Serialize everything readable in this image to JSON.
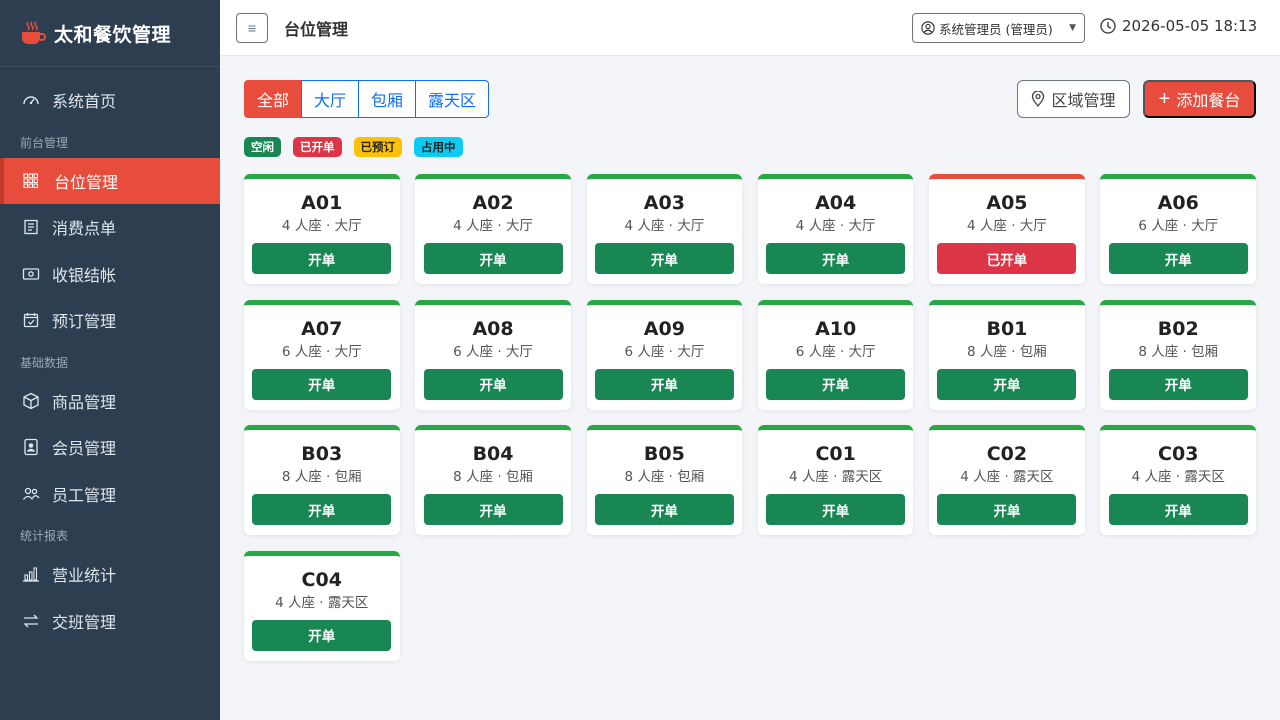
{
  "brand": {
    "title": "太和餐饮管理"
  },
  "sidebar": {
    "items": [
      {
        "type": "item",
        "label": "系统首页",
        "icon": "speedometer-icon",
        "name": "sidebar-item-home"
      },
      {
        "type": "section",
        "label": "前台管理"
      },
      {
        "type": "item",
        "label": "台位管理",
        "icon": "grid-icon",
        "name": "sidebar-item-tables",
        "active": true
      },
      {
        "type": "item",
        "label": "消费点单",
        "icon": "receipt-icon",
        "name": "sidebar-item-orders"
      },
      {
        "type": "item",
        "label": "收银结帐",
        "icon": "cash-icon",
        "name": "sidebar-item-checkout"
      },
      {
        "type": "item",
        "label": "预订管理",
        "icon": "calendar-check-icon",
        "name": "sidebar-item-reservations"
      },
      {
        "type": "section",
        "label": "基础数据"
      },
      {
        "type": "item",
        "label": "商品管理",
        "icon": "box-icon",
        "name": "sidebar-item-products"
      },
      {
        "type": "item",
        "label": "会员管理",
        "icon": "member-card-icon",
        "name": "sidebar-item-members"
      },
      {
        "type": "item",
        "label": "员工管理",
        "icon": "people-icon",
        "name": "sidebar-item-staff"
      },
      {
        "type": "section",
        "label": "统计报表"
      },
      {
        "type": "item",
        "label": "营业统计",
        "icon": "bar-chart-icon",
        "name": "sidebar-item-stats"
      },
      {
        "type": "item",
        "label": "交班管理",
        "icon": "arrows-swap-icon",
        "name": "sidebar-item-shift"
      }
    ]
  },
  "header": {
    "menu_glyph": "≡",
    "title": "台位管理",
    "user_label": "系统管理员 (管理员)",
    "datetime": "2026-05-05 18:13"
  },
  "toolbar": {
    "filters": [
      {
        "label": "全部",
        "active": true
      },
      {
        "label": "大厅",
        "active": false
      },
      {
        "label": "包厢",
        "active": false
      },
      {
        "label": "露天区",
        "active": false
      }
    ],
    "area_button": "区域管理",
    "add_button": "添加餐台",
    "add_glyph": "+"
  },
  "legend": [
    {
      "label": "空闲",
      "color": "green"
    },
    {
      "label": "已开单",
      "color": "red"
    },
    {
      "label": "已预订",
      "color": "yellow"
    },
    {
      "label": "占用中",
      "color": "cyan"
    }
  ],
  "tables": [
    {
      "name": "A01",
      "meta": "4 人座 · 大厅",
      "action": "开单",
      "status": "free"
    },
    {
      "name": "A02",
      "meta": "4 人座 · 大厅",
      "action": "开单",
      "status": "free"
    },
    {
      "name": "A03",
      "meta": "4 人座 · 大厅",
      "action": "开单",
      "status": "free"
    },
    {
      "name": "A04",
      "meta": "4 人座 · 大厅",
      "action": "开单",
      "status": "free"
    },
    {
      "name": "A05",
      "meta": "4 人座 · 大厅",
      "action": "已开单",
      "status": "open"
    },
    {
      "name": "A06",
      "meta": "6 人座 · 大厅",
      "action": "开单",
      "status": "free"
    },
    {
      "name": "A07",
      "meta": "6 人座 · 大厅",
      "action": "开单",
      "status": "free"
    },
    {
      "name": "A08",
      "meta": "6 人座 · 大厅",
      "action": "开单",
      "status": "free"
    },
    {
      "name": "A09",
      "meta": "6 人座 · 大厅",
      "action": "开单",
      "status": "free"
    },
    {
      "name": "A10",
      "meta": "6 人座 · 大厅",
      "action": "开单",
      "status": "free"
    },
    {
      "name": "B01",
      "meta": "8 人座 · 包厢",
      "action": "开单",
      "status": "free"
    },
    {
      "name": "B02",
      "meta": "8 人座 · 包厢",
      "action": "开单",
      "status": "free"
    },
    {
      "name": "B03",
      "meta": "8 人座 · 包厢",
      "action": "开单",
      "status": "free"
    },
    {
      "name": "B04",
      "meta": "8 人座 · 包厢",
      "action": "开单",
      "status": "free"
    },
    {
      "name": "B05",
      "meta": "8 人座 · 包厢",
      "action": "开单",
      "status": "free"
    },
    {
      "name": "C01",
      "meta": "4 人座 · 露天区",
      "action": "开单",
      "status": "free"
    },
    {
      "name": "C02",
      "meta": "4 人座 · 露天区",
      "action": "开单",
      "status": "free"
    },
    {
      "name": "C03",
      "meta": "4 人座 · 露天区",
      "action": "开单",
      "status": "free"
    },
    {
      "name": "C04",
      "meta": "4 人座 · 露天区",
      "action": "开单",
      "status": "free"
    }
  ]
}
